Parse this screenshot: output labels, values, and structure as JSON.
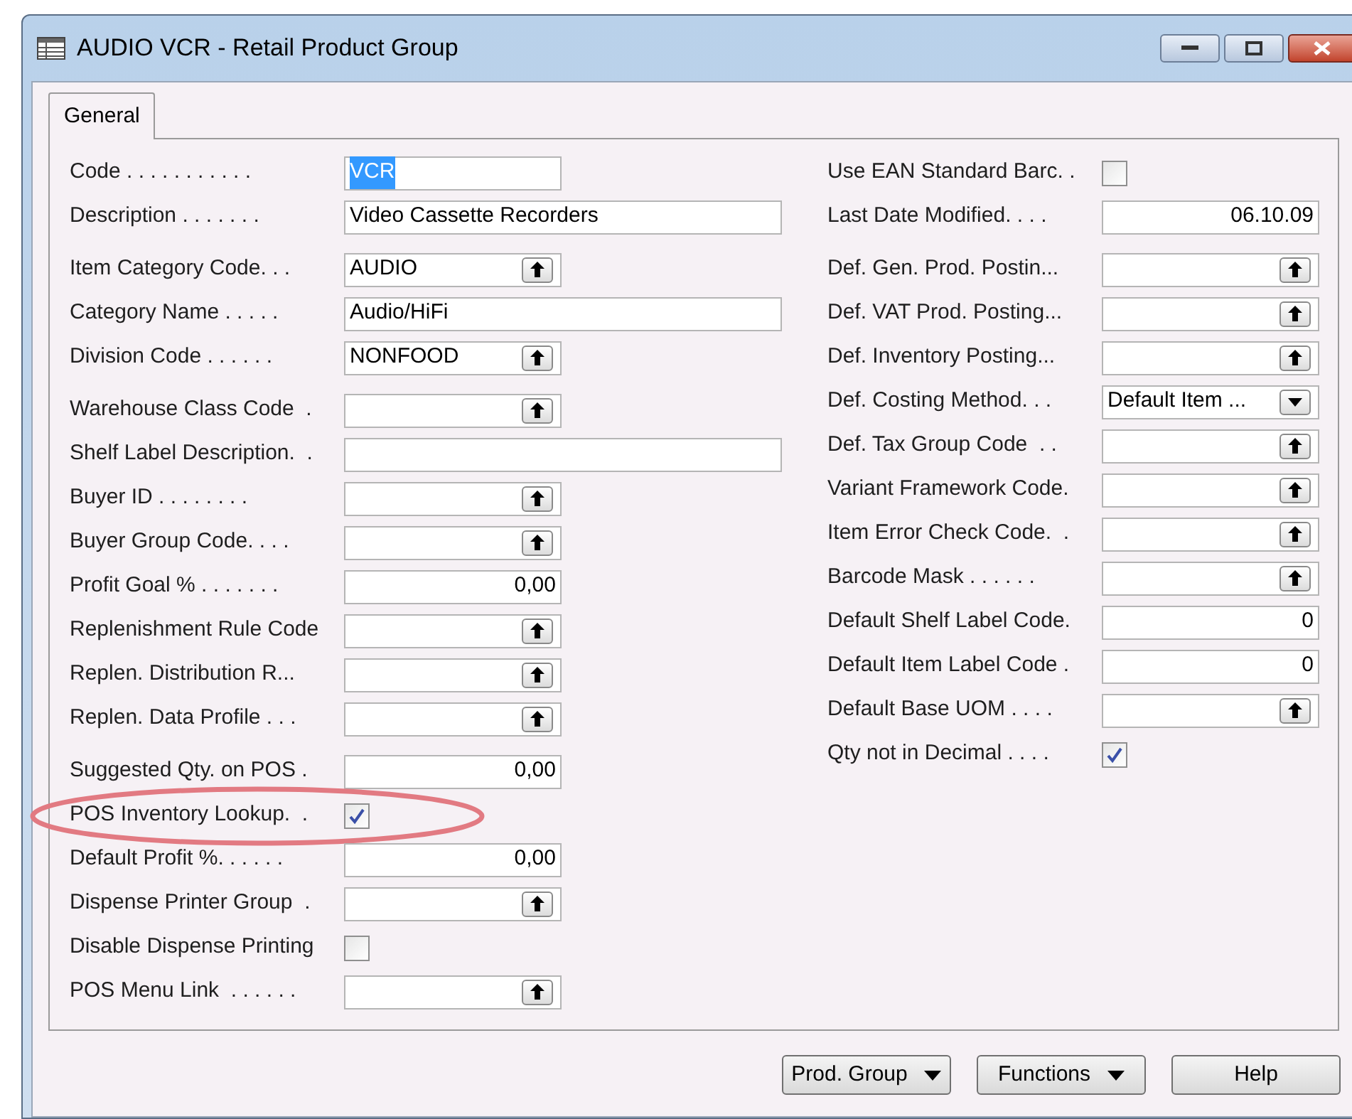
{
  "window": {
    "title": "AUDIO VCR - Retail Product Group"
  },
  "tabs": [
    {
      "label": "General",
      "selected": true
    }
  ],
  "left_groups": [
    [
      {
        "label": "Code . . . . . . . . . . .",
        "kind": "text",
        "value": "VCR",
        "text_selected": true
      },
      {
        "label": "Description . . . . . . .",
        "kind": "long_text",
        "value": "Video Cassette Recorders"
      }
    ],
    [
      {
        "label": "Item Category Code. . .",
        "kind": "lookup",
        "value": "AUDIO"
      },
      {
        "label": "Category Name . . . . .",
        "kind": "long_text",
        "value": "Audio/HiFi"
      },
      {
        "label": "Division Code . . . . . .",
        "kind": "lookup",
        "value": "NONFOOD"
      }
    ],
    [
      {
        "label": "Warehouse Class Code  .",
        "kind": "lookup"
      },
      {
        "label": "Shelf Label Description.  .",
        "kind": "long_text"
      },
      {
        "label": "Buyer ID . . . . . . . .",
        "kind": "lookup"
      },
      {
        "label": "Buyer Group Code. . . .",
        "kind": "lookup"
      },
      {
        "label": "Profit Goal % . . . . . . .",
        "kind": "number",
        "value": "0,00"
      },
      {
        "label": "Replenishment Rule Code",
        "kind": "lookup"
      },
      {
        "label": "Replen. Distribution R...",
        "kind": "lookup"
      },
      {
        "label": "Replen. Data Profile . . .",
        "kind": "lookup"
      }
    ],
    [
      {
        "label": "Suggested Qty. on POS .",
        "kind": "number",
        "value": "0,00"
      },
      {
        "label": "POS Inventory Lookup.  .",
        "kind": "checkbox",
        "checked": true,
        "highlighted": true
      },
      {
        "label": "Default Profit %. . . . . .",
        "kind": "number",
        "value": "0,00"
      },
      {
        "label": "Dispense Printer Group  .",
        "kind": "lookup"
      },
      {
        "label": "Disable Dispense Printing",
        "kind": "checkbox",
        "checked": false
      },
      {
        "label": "POS Menu Link  . . . . . .",
        "kind": "lookup"
      }
    ]
  ],
  "right_groups": [
    [
      {
        "label": "Use EAN Standard Barc. .",
        "kind": "checkbox",
        "checked": false
      },
      {
        "label": "Last Date Modified. . . .",
        "kind": "number",
        "value": "06.10.09"
      }
    ],
    [
      {
        "label": "Def. Gen. Prod. Postin...",
        "kind": "lookup"
      },
      {
        "label": "Def. VAT Prod. Posting...",
        "kind": "lookup"
      },
      {
        "label": "Def. Inventory Posting...",
        "kind": "lookup"
      },
      {
        "label": "Def. Costing Method. . .",
        "kind": "option",
        "value": "Default Item ..."
      },
      {
        "label": "Def. Tax Group Code  . .",
        "kind": "lookup"
      },
      {
        "label": "Variant Framework Code.",
        "kind": "lookup"
      },
      {
        "label": "Item Error Check Code.  .",
        "kind": "lookup"
      },
      {
        "label": "Barcode Mask . . . . . .",
        "kind": "lookup"
      },
      {
        "label": "Default Shelf Label Code.",
        "kind": "number",
        "value": "0"
      },
      {
        "label": "Default Item Label Code .",
        "kind": "number",
        "value": "0"
      },
      {
        "label": "Default Base UOM . . . .",
        "kind": "lookup"
      },
      {
        "label": "Qty not in Decimal . . . .",
        "kind": "checkbox",
        "checked": true
      }
    ]
  ],
  "buttons": [
    {
      "label": "Prod. Group",
      "menu": true
    },
    {
      "label": "Functions",
      "menu": true
    },
    {
      "label": "Help",
      "menu": false
    }
  ]
}
